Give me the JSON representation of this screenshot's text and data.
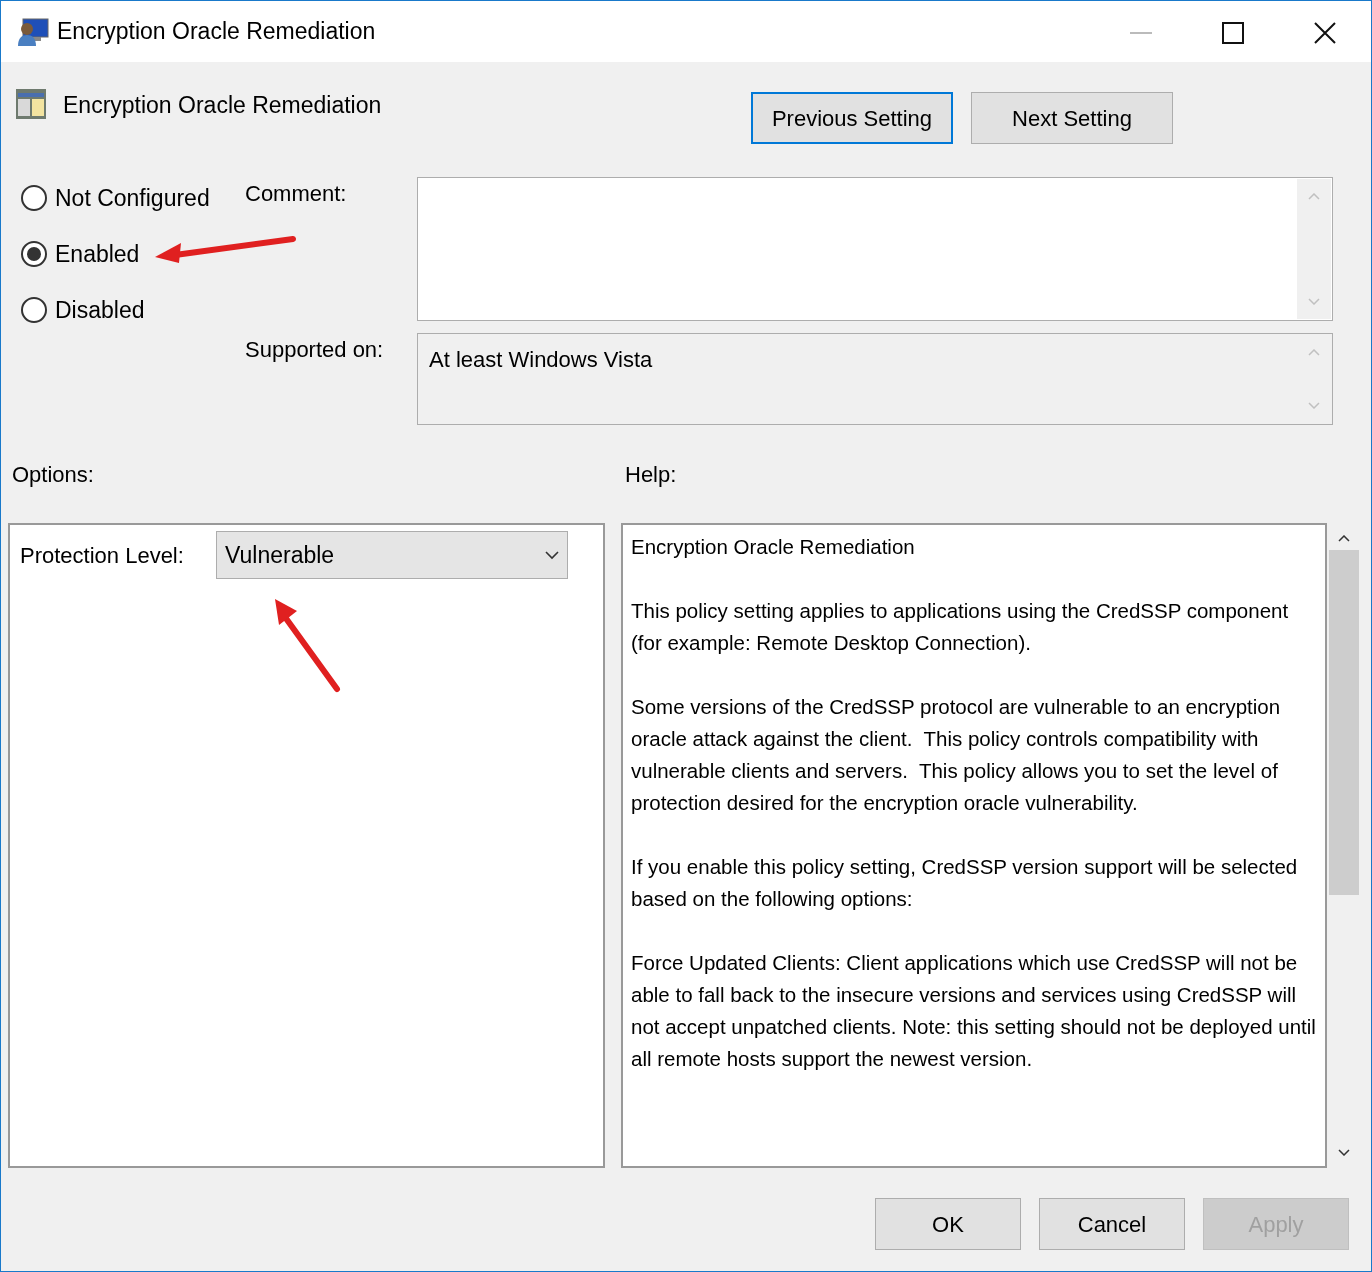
{
  "window": {
    "title": "Encryption Oracle Remediation"
  },
  "setting": {
    "name": "Encryption Oracle Remediation"
  },
  "nav_buttons": [
    {
      "label": "Previous Setting",
      "focused": true
    },
    {
      "label": "Next Setting",
      "focused": false
    }
  ],
  "state_options": [
    {
      "label": "Not Configured",
      "selected": false
    },
    {
      "label": "Enabled",
      "selected": true
    },
    {
      "label": "Disabled",
      "selected": false
    }
  ],
  "comment": {
    "label": "Comment:"
  },
  "supported_on": {
    "label": "Supported on:",
    "value": "At least Windows Vista"
  },
  "options": {
    "label": "Options:",
    "fields": [
      {
        "label": "Protection Level:",
        "value": "Vulnerable"
      }
    ]
  },
  "help": {
    "label": "Help:",
    "paragraphs": [
      "Encryption Oracle Remediation",
      "This policy setting applies to applications using the CredSSP component (for example: Remote Desktop Connection).",
      "Some versions of the CredSSP protocol are vulnerable to an encryption oracle attack against the client.  This policy controls compatibility with vulnerable clients and servers.  This policy allows you to set the level of protection desired for the encryption oracle vulnerability.",
      "If you enable this policy setting, CredSSP version support will be selected based on the following options:",
      "Force Updated Clients: Client applications which use CredSSP will not be able to fall back to the insecure versions and services using CredSSP will not accept unpatched clients. Note: this setting should not be deployed until all remote hosts support the newest version."
    ]
  },
  "buttons": [
    {
      "label": "OK",
      "disabled": false
    },
    {
      "label": "Cancel",
      "disabled": false
    },
    {
      "label": "Apply",
      "disabled": true
    }
  ]
}
